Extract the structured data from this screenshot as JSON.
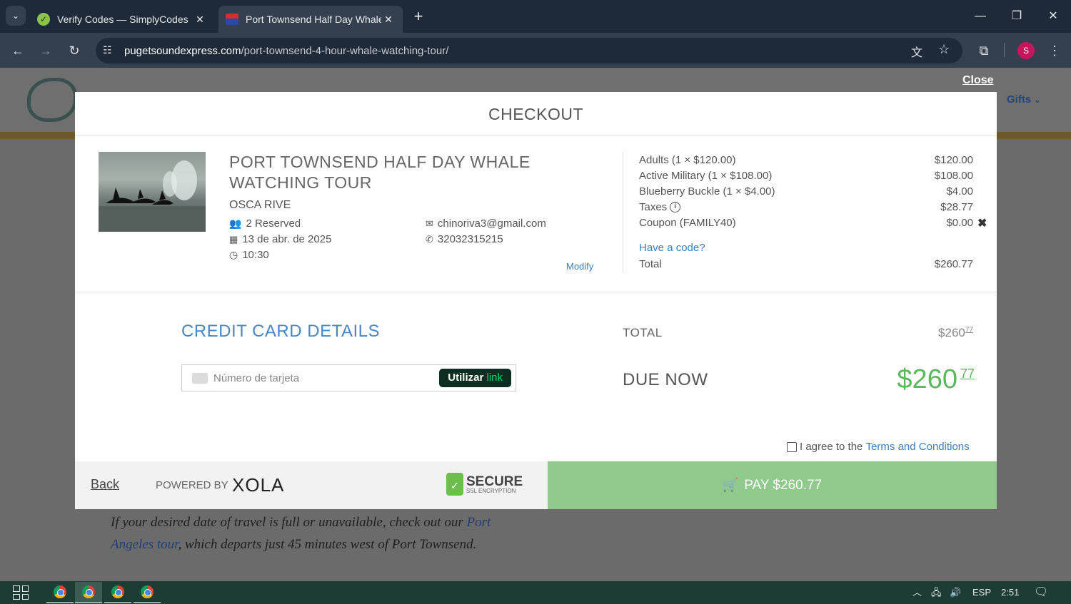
{
  "browser": {
    "tabs": [
      {
        "title": "Verify Codes — SimplyCodes"
      },
      {
        "title": "Port Townsend Half Day Whale"
      }
    ],
    "url_domain": "pugetsoundexpress.com",
    "url_path": "/port-townsend-4-hour-whale-watching-tour/",
    "profile_initial": "S"
  },
  "background_page": {
    "nav_gifts": "Gifts",
    "text_prefix": "If your desired date of travel is full or unavailable, check out our ",
    "link_text": "Port Angeles tour",
    "text_suffix": ", which departs just 45 minutes west of Port Townsend."
  },
  "modal": {
    "close_label": "Close",
    "title": "CHECKOUT",
    "tour_name": "PORT TOWNSEND HALF DAY WHALE WATCHING TOUR",
    "customer": "OSCA RIVE",
    "reserved": "2 Reserved",
    "date": "13 de abr. de 2025",
    "time": "10:30",
    "email": "chinoriva3@gmail.com",
    "phone": "32032315215",
    "modify_label": "Modify",
    "line_items": [
      {
        "label": "Adults (1 × $120.00)",
        "value": "$120.00"
      },
      {
        "label": "Active Military (1 × $108.00)",
        "value": "$108.00"
      },
      {
        "label": "Blueberry Buckle (1 × $4.00)",
        "value": "$4.00"
      },
      {
        "label": "Taxes",
        "value": "$28.77"
      },
      {
        "label": "Coupon (FAMILY40)",
        "value": "$0.00"
      }
    ],
    "have_code_label": "Have a code?",
    "total_label": "Total",
    "total_value": "$260.77",
    "cc_title": "CREDIT CARD DETAILS",
    "card_placeholder": "Número de tarjeta",
    "link_button_prefix": "Utilizar",
    "link_button_brand": "link",
    "summary_total_label": "TOTAL",
    "summary_total_main": "$260",
    "summary_total_cents": "77",
    "due_now_label": "DUE NOW",
    "due_now_main": "$260",
    "due_now_cents": "77",
    "agree_text": "I agree to the ",
    "terms_label": "Terms and Conditions",
    "back_label": "Back",
    "powered_by": "POWERED BY",
    "xola_logo": "XOLA",
    "secure_title": "SECURE",
    "secure_sub": "SSL ENCRYPTION",
    "pay_label": "PAY $260.77"
  },
  "taskbar": {
    "language": "ESP",
    "clock": "2:51"
  },
  "colors": {
    "accent_blue": "#4a87c3",
    "due_green": "#5cb85c",
    "pay_green": "#90c98c"
  }
}
